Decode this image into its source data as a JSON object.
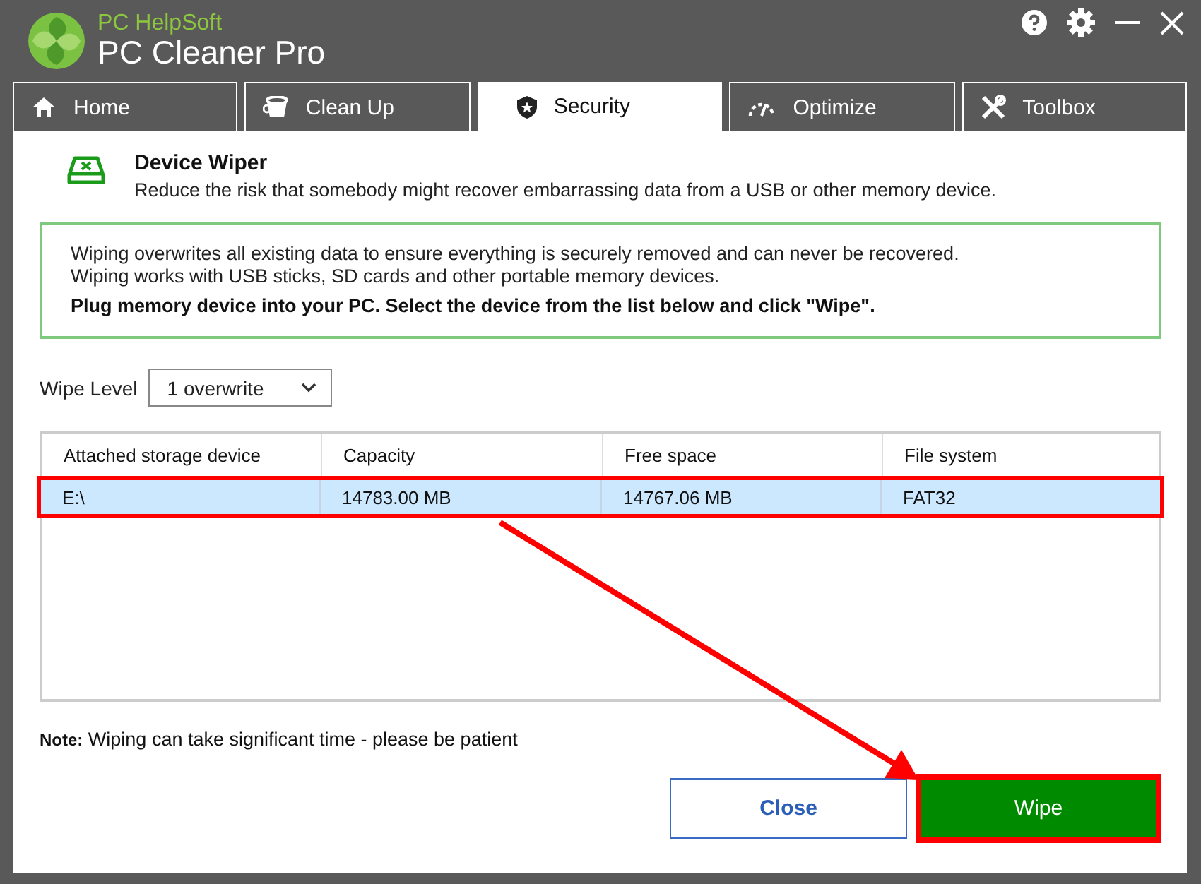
{
  "app": {
    "vendor": "PC HelpSoft",
    "name": "PC Cleaner Pro"
  },
  "tabs": [
    {
      "label": "Home",
      "kind": "home",
      "selected": false
    },
    {
      "label": "Clean Up",
      "kind": "cleanup",
      "selected": false
    },
    {
      "label": "Security",
      "kind": "security",
      "selected": true
    },
    {
      "label": "Optimize",
      "kind": "optimize",
      "selected": false
    },
    {
      "label": "Toolbox",
      "kind": "toolbox",
      "selected": false
    }
  ],
  "section": {
    "title": "Device Wiper",
    "description": "Reduce the risk that somebody might recover embarrassing data from a USB or other memory device."
  },
  "info": {
    "lines": [
      "Wiping overwrites all existing data to ensure everything is securely removed and can never be recovered.",
      "Wiping works with USB sticks, SD cards and other portable memory devices."
    ],
    "instruction": "Plug memory device into your PC. Select the device from the list below and click \"Wipe\"."
  },
  "wipe_level": {
    "label": "Wipe Level",
    "value": "1 overwrite"
  },
  "table": {
    "columns": [
      "Attached storage device",
      "Capacity",
      "Free space",
      "File system"
    ],
    "rows": [
      {
        "cells": [
          "E:\\",
          "14783.00 MB",
          "14767.06 MB",
          "FAT32"
        ],
        "selected": true,
        "annotated": true
      }
    ]
  },
  "note": "**Note:** Wiping can take significant time - please be patient",
  "buttons": [
    {
      "label": "Close",
      "kind": "secondary",
      "annotated": false
    },
    {
      "label": "Wipe",
      "kind": "primary",
      "annotated": true
    }
  ]
}
